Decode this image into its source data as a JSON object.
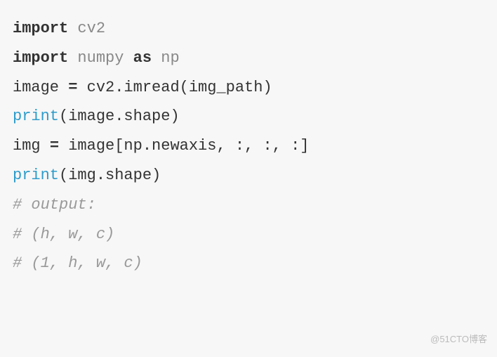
{
  "code": {
    "line1": {
      "import": "import",
      "cv2": "cv2"
    },
    "line2": {
      "import": "import",
      "numpy": "numpy",
      "as": "as",
      "np": "np"
    },
    "line3": "",
    "line4": {
      "text": "image ",
      "eq": "=",
      "rest": " cv2.imread(img_path)"
    },
    "line5": {
      "print": "print",
      "args": "(image.shape)"
    },
    "line6": {
      "text": "img ",
      "eq": "=",
      "rest": " image[np.newaxis, :, :, :]"
    },
    "line7": {
      "print": "print",
      "args": "(img.shape)"
    },
    "line8": "",
    "line9": "# output:",
    "line10": "# (h, w, c)",
    "line11": "# (1, h, w, c)"
  },
  "watermark": "@51CTO博客"
}
